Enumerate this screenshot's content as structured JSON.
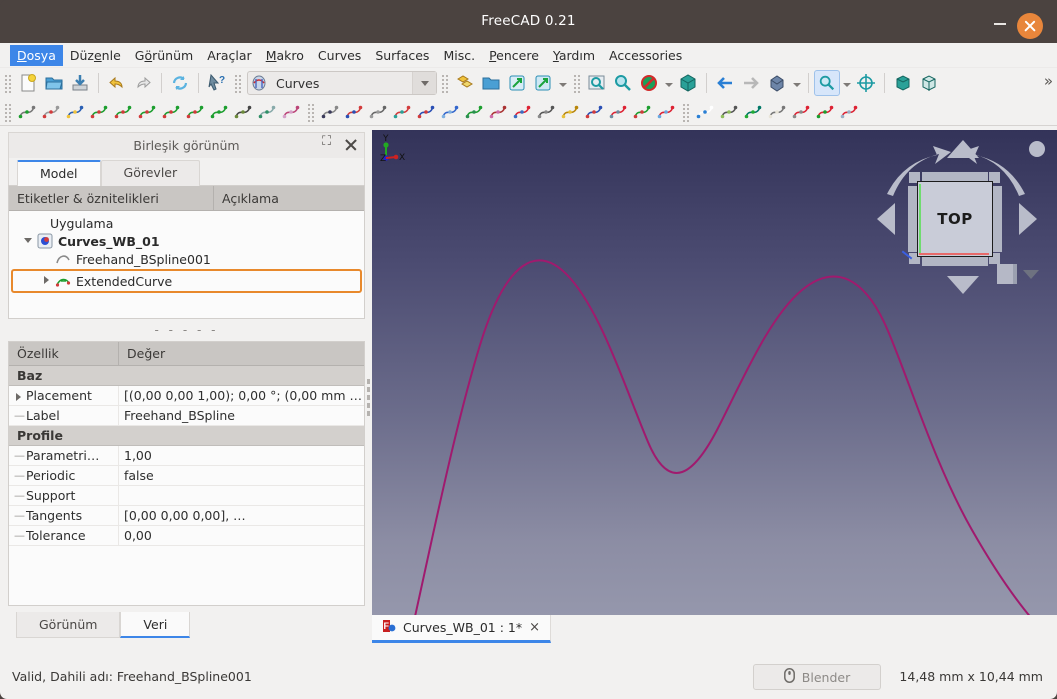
{
  "window": {
    "title": "FreeCAD 0.21",
    "minimize_label": "–",
    "close_label": "×"
  },
  "menubar": {
    "items": [
      {
        "label": "Dosya",
        "accel_index": 0,
        "active": true
      },
      {
        "label": "Düzenle",
        "accel_index": 3,
        "active": false
      },
      {
        "label": "Görünüm",
        "accel_index": 1,
        "active": false
      },
      {
        "label": "Araçlar",
        "accel_index": -1,
        "active": false
      },
      {
        "label": "Makro",
        "accel_index": 0,
        "active": false
      },
      {
        "label": "Curves",
        "accel_index": -1,
        "active": false
      },
      {
        "label": "Surfaces",
        "accel_index": -1,
        "active": false
      },
      {
        "label": "Misc.",
        "accel_index": -1,
        "active": false
      },
      {
        "label": "Pencere",
        "accel_index": 0,
        "active": false
      },
      {
        "label": "Yardım",
        "accel_index": 0,
        "active": false
      },
      {
        "label": "Accessories",
        "accel_index": -1,
        "active": false
      }
    ]
  },
  "toolbar_row1": {
    "workbench_selector": {
      "value": "Curves",
      "icon": "curves-workbench-icon"
    },
    "overflow_label": "»",
    "buttons": [
      {
        "name": "new-document-icon",
        "title": "New"
      },
      {
        "name": "open-document-icon",
        "title": "Open"
      },
      {
        "name": "save-document-icon",
        "title": "Save"
      },
      {
        "name": "undo-icon",
        "title": "Undo"
      },
      {
        "name": "redo-icon",
        "title": "Redo"
      },
      {
        "name": "refresh-icon",
        "title": "Refresh"
      },
      {
        "name": "whats-this-icon",
        "title": "What's This"
      },
      {
        "name": "std-group-icon",
        "title": "Group"
      },
      {
        "name": "folder-icon",
        "title": "Folder"
      },
      {
        "name": "link-make-icon",
        "title": "Make Link"
      },
      {
        "name": "link-group-icon",
        "title": "Make Link Group"
      },
      {
        "name": "fit-all-icon",
        "title": "Fit All"
      },
      {
        "name": "zoom-icon",
        "title": "Zoom"
      },
      {
        "name": "draw-style-icon",
        "title": "Draw Style"
      },
      {
        "name": "axonometric-icon",
        "title": "Axonometric"
      },
      {
        "name": "back-arrow-icon",
        "title": "Back"
      },
      {
        "name": "forward-arrow-icon",
        "title": "Forward"
      },
      {
        "name": "isometric-view-icon",
        "title": "Isometric"
      },
      {
        "name": "zoom-box-icon",
        "title": "Box Zoom",
        "checked": true
      },
      {
        "name": "fit-selection-icon",
        "title": "Fit Selection"
      },
      {
        "name": "clip-plane-icon",
        "title": "Clipping Plane"
      },
      {
        "name": "texture-box-icon",
        "title": "Texture"
      }
    ]
  },
  "toolbar_row2": {
    "buttons": [
      {
        "name": "line-icon"
      },
      {
        "name": "bspline-icon"
      },
      {
        "name": "editable-spline-icon"
      },
      {
        "name": "join-curve-icon"
      },
      {
        "name": "discretize-icon"
      },
      {
        "name": "approximate-icon"
      },
      {
        "name": "interpolate-icon"
      },
      {
        "name": "extend-curve-icon"
      },
      {
        "name": "parametric-blend-icon"
      },
      {
        "name": "curve-extend-x-icon"
      },
      {
        "name": "pipeshell-profile-icon"
      },
      {
        "name": "gordon-surface-icon"
      },
      {
        "name": "zebra-stripes-icon"
      },
      {
        "name": "blend-surface-icon"
      },
      {
        "name": "ruled-surface-icon"
      },
      {
        "name": "sweep-surface-icon"
      },
      {
        "name": "profile-support-icon"
      },
      {
        "name": "flatten-face-icon"
      },
      {
        "name": "pipeshell-icon"
      },
      {
        "name": "curve-on-surface-icon"
      },
      {
        "name": "segment-surface-icon"
      },
      {
        "name": "isocurve-icon"
      },
      {
        "name": "sphere-icon"
      },
      {
        "name": "solid-from-shells-icon"
      },
      {
        "name": "surface-trim-icon"
      },
      {
        "name": "trim-face-icon"
      },
      {
        "name": "mixed-curve-icon"
      },
      {
        "name": "info-icon"
      },
      {
        "name": "box-element-info-icon"
      },
      {
        "name": "green-cube-icon"
      },
      {
        "name": "clipboard-icon"
      },
      {
        "name": "cube-arrow-icon"
      },
      {
        "name": "grid-icon"
      },
      {
        "name": "sketch-on-surface-icon"
      }
    ]
  },
  "dock": {
    "title": "Birleşik görünüm",
    "float_icon": "restore-icon",
    "close_icon": "close-icon",
    "tabs": [
      {
        "label": "Model",
        "selected": true
      },
      {
        "label": "Görevler",
        "selected": false
      }
    ],
    "separator": "- - - - -"
  },
  "tree": {
    "headers": [
      "Etiketler & öznitelikleri",
      "Açıklama"
    ],
    "nodes": [
      {
        "label": "Uygulama",
        "level": 1,
        "bold": false,
        "twist": "none",
        "icon": "",
        "selected": false
      },
      {
        "label": "Curves_WB_01",
        "level": 2,
        "bold": true,
        "twist": "down",
        "icon": "document-icon",
        "selected": false
      },
      {
        "label": "Freehand_BSpline001",
        "level": 3,
        "bold": false,
        "twist": "none",
        "icon": "bspline-curve-icon",
        "selected": false
      },
      {
        "label": "ExtendedCurve",
        "level": 3,
        "bold": false,
        "twist": "right",
        "icon": "extended-curve-icon",
        "selected": true
      }
    ]
  },
  "properties": {
    "headers": [
      "Özellik",
      "Değer"
    ],
    "rows": [
      {
        "type": "group",
        "key": "Baz",
        "value": ""
      },
      {
        "type": "item",
        "key": "Placement",
        "value": "[(0,00 0,00 1,00); 0,00 °; (0,00 mm …",
        "expandable": true
      },
      {
        "type": "item",
        "key": "Label",
        "value": "Freehand_BSpline",
        "expandable": false
      },
      {
        "type": "group",
        "key": "Profile",
        "value": ""
      },
      {
        "type": "item",
        "key": "Parametri…",
        "value": "1,00",
        "expandable": false
      },
      {
        "type": "item",
        "key": "Periodic",
        "value": "false",
        "expandable": false
      },
      {
        "type": "item",
        "key": "Support",
        "value": "",
        "expandable": false
      },
      {
        "type": "item",
        "key": "Tangents",
        "value": "[0,00 0,00 0,00], …",
        "expandable": false
      },
      {
        "type": "item",
        "key": "Tolerance",
        "value": "0,00",
        "expandable": false
      }
    ]
  },
  "bottom_tabs": [
    {
      "label": "Görünüm",
      "selected": false
    },
    {
      "label": "Veri",
      "selected": true
    }
  ],
  "viewport": {
    "navcube": {
      "face_label": "TOP",
      "up_arrow_icon": "nav-up-icon",
      "down_arrow_icon": "nav-down-icon",
      "left_arrow_icon": "nav-left-icon",
      "right_arrow_icon": "nav-right-icon",
      "rotate_left_icon": "rotate-ccw-icon",
      "rotate_right_icon": "rotate-cw-icon",
      "home_dot_icon": "view-home-icon",
      "corner_cube_icon": "corner-cube-icon",
      "corner_caret_icon": "corner-caret-icon"
    },
    "axis_indicator": {
      "x_label": "X",
      "y_label": "Y",
      "z_label": "Z",
      "x_color": "#cc2222",
      "y_color": "#22aa22",
      "z_color": "#2222cc"
    },
    "curve_color": "#a01a6e",
    "background_top": "#333359",
    "background_bottom": "#9597ac"
  },
  "mdi_tabs": [
    {
      "label": "Curves_WB_01 : 1*",
      "icon": "freecad-doc-icon",
      "close": "×",
      "selected": true
    }
  ],
  "statusbar": {
    "message": "Valid, Dahili adı: Freehand_BSpline001",
    "nav_style_button": {
      "label": "Blender",
      "icon": "mouse-icon"
    },
    "dimensions": "14,48 mm x 10,44 mm"
  }
}
